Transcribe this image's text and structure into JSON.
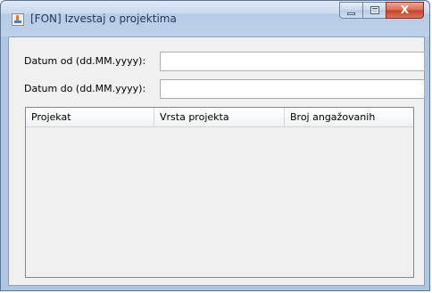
{
  "window": {
    "title": "[FON] Izvestaj o projektima",
    "close_glyph": "X"
  },
  "form": {
    "date_from_label": "Datum od (dd.MM.yyyy):",
    "date_from_value": "",
    "date_to_label": "Datum do (dd.MM.yyyy):",
    "date_to_value": ""
  },
  "table": {
    "columns": [
      "Projekat",
      "Vrsta projekta",
      "Broj angažovanih"
    ],
    "rows": []
  },
  "icons": {
    "app": "java-app-icon",
    "minimize": "minimize-icon",
    "maximize": "maximize-icon",
    "close": "close-icon"
  },
  "colors": {
    "titlebar": "#bed1ea",
    "client_background": "#f0f0f0",
    "close_button": "#c4412a"
  }
}
